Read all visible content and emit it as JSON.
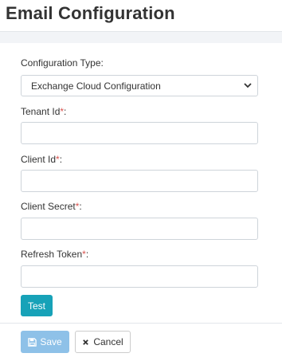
{
  "header": {
    "title": "Email Configuration"
  },
  "form": {
    "config_type": {
      "label": "Configuration Type:",
      "selected": "Exchange Cloud Configuration"
    },
    "tenant_id": {
      "label": "Tenant Id",
      "required_mark": "*",
      "suffix": ":",
      "value": ""
    },
    "client_id": {
      "label": "Client Id",
      "required_mark": "*",
      "suffix": ":",
      "value": ""
    },
    "client_secret": {
      "label": "Client Secret",
      "required_mark": "*",
      "suffix": ":",
      "value": ""
    },
    "refresh_token": {
      "label": "Refresh Token",
      "required_mark": "*",
      "suffix": ":",
      "value": ""
    },
    "test_label": "Test"
  },
  "footer": {
    "save_label": "Save",
    "cancel_label": "Cancel"
  },
  "colors": {
    "required": "#d9534f",
    "test_button": "#17a2b8",
    "save_button": "#8ec1e8"
  },
  "icons": {
    "save": "floppy-disk-icon",
    "cancel": "x-icon",
    "select": "chevron-down-icon"
  }
}
